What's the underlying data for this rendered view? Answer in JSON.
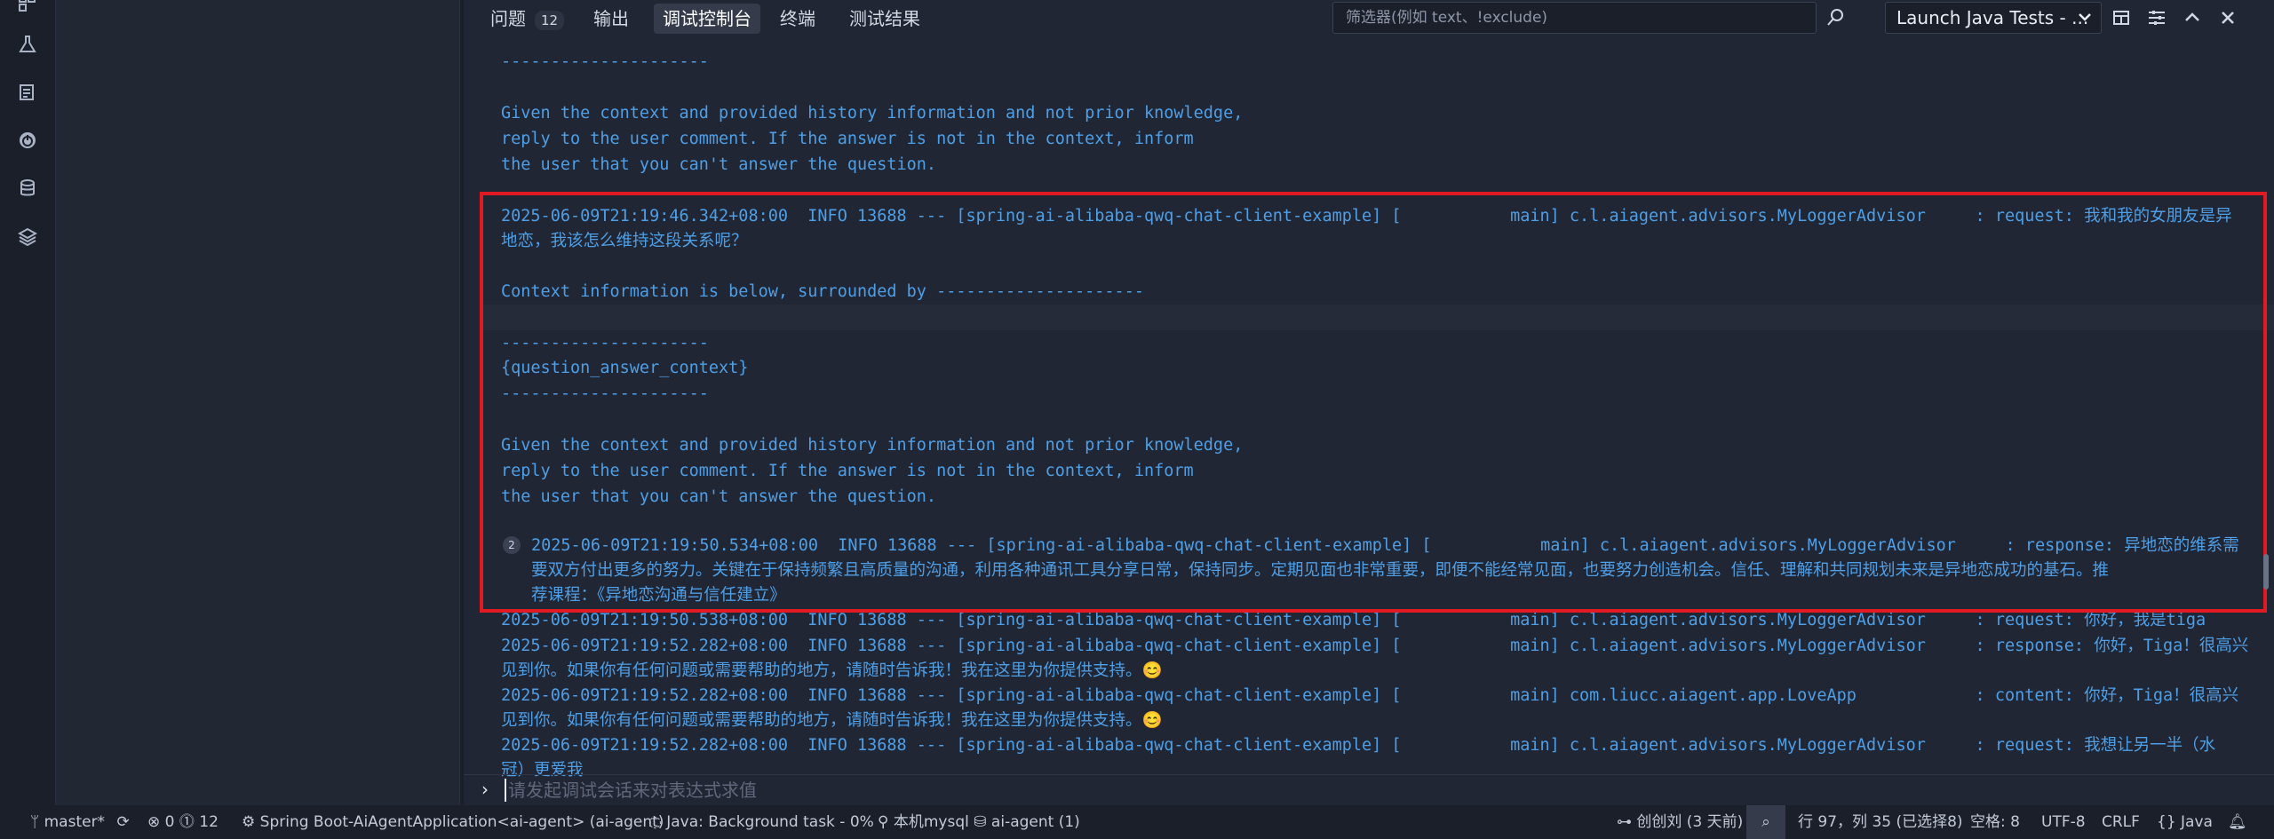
{
  "activity_bar": {
    "icons": [
      "extensions-icon",
      "flask-icon",
      "clipboard-icon",
      "power-icon",
      "database-icon",
      "layers-icon"
    ]
  },
  "panel": {
    "tabs": [
      {
        "label": "问题",
        "badge": "12"
      },
      {
        "label": "输出"
      },
      {
        "label": "调试控制台",
        "active": true
      },
      {
        "label": "终端"
      },
      {
        "label": "测试结果"
      }
    ],
    "filter_placeholder": "筛选器(例如 text、!exclude)",
    "launch_config": "Launch Java Tests - ...",
    "console_lines": [
      "---------------------",
      "",
      "Given the context and provided history information and not prior knowledge,",
      "reply to the user comment. If the answer is not in the context, inform",
      "the user that you can't answer the question.",
      "",
      "2025-06-09T21:19:46.342+08:00  INFO 13688 --- [spring-ai-alibaba-qwq-chat-client-example] [           main] c.l.aiagent.advisors.MyLoggerAdvisor     : request: 我和我的女朋友是异",
      "地恋，我该怎么维持这段关系呢？",
      "",
      "Context information is below, surrounded by ---------------------",
      "",
      "---------------------",
      "{question_answer_context}",
      "---------------------",
      "",
      "Given the context and provided history information and not prior knowledge,",
      "reply to the user comment. If the answer is not in the context, inform",
      "the user that you can't answer the question.",
      "",
      "2025-06-09T21:19:50.534+08:00  INFO 13688 --- [spring-ai-alibaba-qwq-chat-client-example] [           main] c.l.aiagent.advisors.MyLoggerAdvisor     : response: 异地恋的维系需",
      "要双方付出更多的努力。关键在于保持频繁且高质量的沟通，利用各种通讯工具分享日常，保持同步。定期见面也非常重要，即便不能经常见面，也要努力创造机会。信任、理解和共同规划未来是异地恋成功的基石。推",
      "荐课程：《异地恋沟通与信任建立》",
      "2025-06-09T21:19:50.538+08:00  INFO 13688 --- [spring-ai-alibaba-qwq-chat-client-example] [           main] c.l.aiagent.advisors.MyLoggerAdvisor     : request: 你好，我是tiga",
      "2025-06-09T21:19:52.282+08:00  INFO 13688 --- [spring-ai-alibaba-qwq-chat-client-example] [           main] c.l.aiagent.advisors.MyLoggerAdvisor     : response: 你好，Tiga！很高兴",
      "见到你。如果你有任何问题或需要帮助的地方，请随时告诉我！我在这里为你提供支持。😊",
      "2025-06-09T21:19:52.282+08:00  INFO 13688 --- [spring-ai-alibaba-qwq-chat-client-example] [           main] com.liucc.aiagent.app.LoveApp            : content: 你好，Tiga！很高兴",
      "见到你。如果你有任何问题或需要帮助的地方，请随时告诉我！我在这里为你提供支持。😊",
      "2025-06-09T21:19:52.282+08:00  INFO 13688 --- [spring-ai-alibaba-qwq-chat-client-example] [           main] c.l.aiagent.advisors.MyLoggerAdvisor     : request: 我想让另一半（水",
      "冠）更爱我"
    ],
    "repeat_count": "2",
    "input_prompt": "›",
    "input_placeholder": "请发起调试会话来对表达式求值"
  },
  "status_bar": {
    "branch": "master*",
    "errors": "0",
    "warnings": "12",
    "run_config": "Spring Boot-AiAgentApplication<ai-agent> (ai-agent)",
    "java_task": "Java: Background task - 0%",
    "db1": "本机mysql",
    "db2": "ai-agent (1)",
    "author": "创创刘 (3 天前)",
    "position": "行 97，列 35 (已选择8)",
    "spaces": "空格: 8",
    "encoding": "UTF-8",
    "eol": "CRLF",
    "language": "Java"
  }
}
